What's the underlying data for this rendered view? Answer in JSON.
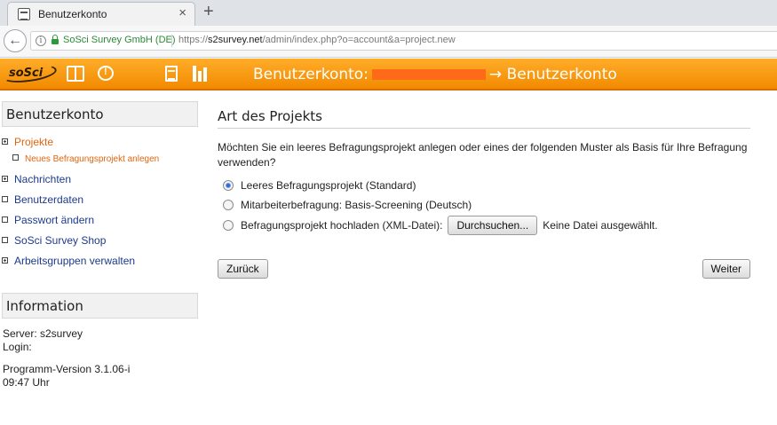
{
  "browser": {
    "tab_title": "Benutzerkonto",
    "tab_close": "×",
    "new_tab": "+",
    "site_identity": "SoSci Survey GmbH (DE)",
    "url_prefix": "https://",
    "url_host": "s2survey.net",
    "url_path": "/admin/index.php?o=account&a=project.new"
  },
  "header": {
    "logo_text": "soSci",
    "title_prefix": "Benutzerkonto:",
    "title_suffix": "→ Benutzerkonto",
    "icons": [
      "book-icon",
      "chat-icon",
      "document-icon",
      "bar-chart-icon"
    ],
    "accent_color": "#f28a00"
  },
  "sidebar": {
    "heading": "Benutzerkonto",
    "items": [
      {
        "label": "Projekte",
        "active": true,
        "bullet": "plus"
      },
      {
        "label": "Neues Befragungsprojekt anlegen",
        "sub": true
      },
      {
        "label": "Nachrichten",
        "bullet": "plus"
      },
      {
        "label": "Benutzerdaten",
        "bullet": "box"
      },
      {
        "label": "Passwort ändern",
        "bullet": "box"
      },
      {
        "label": "SoSci Survey Shop",
        "bullet": "box"
      },
      {
        "label": "Arbeitsgruppen verwalten",
        "bullet": "plus"
      }
    ]
  },
  "info": {
    "heading": "Information",
    "server": "Server: s2survey",
    "login": "Login:",
    "version": "Programm-Version 3.1.06-i",
    "time": "09:47 Uhr"
  },
  "main": {
    "title": "Art des Projekts",
    "intro": "Möchten Sie ein leeres Befragungsprojekt anlegen oder eines der folgenden Muster als Basis für Ihre Befragung verwenden?",
    "options": [
      {
        "label": "Leeres Befragungsprojekt (Standard)",
        "checked": true
      },
      {
        "label": "Mitarbeiterbefragung: Basis-Screening (Deutsch)",
        "checked": false
      },
      {
        "label": "Befragungsprojekt hochladen (XML-Datei):",
        "checked": false
      }
    ],
    "browse_label": "Durchsuchen...",
    "no_file": "Keine Datei ausgewählt.",
    "back_label": "Zurück",
    "next_label": "Weiter"
  }
}
